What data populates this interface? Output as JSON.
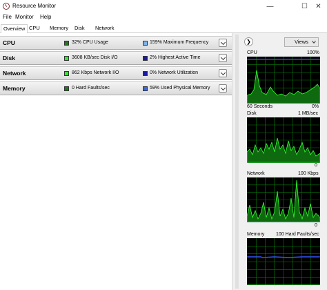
{
  "window": {
    "title": "Resource Monitor",
    "minimize": "—",
    "maximize": "☐",
    "close": "✕"
  },
  "menu": {
    "file": "File",
    "monitor": "Monitor",
    "help": "Help"
  },
  "tabs": {
    "overview": "Overview",
    "cpu": "CPU",
    "memory": "Memory",
    "disk": "Disk",
    "network": "Network"
  },
  "sections": {
    "cpu": {
      "title": "CPU",
      "stat1": "32% CPU Usage",
      "stat1_color": "#1f7a1f",
      "stat2": "159% Maximum Frequency",
      "stat2_color": "#7fb2e8"
    },
    "disk": {
      "title": "Disk",
      "stat1": "3608 KB/sec Disk I/O",
      "stat1_color": "#2ee82e",
      "stat2": "2% Highest Active Time",
      "stat2_color": "#1a1aa0"
    },
    "network": {
      "title": "Network",
      "stat1": "862 Kbps Network I/O",
      "stat1_color": "#2ee82e",
      "stat2": "0% Network Utilization",
      "stat2_color": "#1a1aa0"
    },
    "memory": {
      "title": "Memory",
      "stat1": "0 Hard Faults/sec",
      "stat1_color": "#1f7a1f",
      "stat2": "59% Used Physical Memory",
      "stat2_color": "#3a6ad8"
    }
  },
  "rightpane": {
    "nav_glyph": "❯",
    "views_label": "Views",
    "cpu": {
      "title": "CPU",
      "max": "100%",
      "time": "60 Seconds",
      "min": "0%"
    },
    "disk": {
      "title": "Disk",
      "max": "1 MB/sec",
      "min": "0"
    },
    "network": {
      "title": "Network",
      "max": "100 Kbps",
      "min": "0"
    },
    "memory": {
      "title": "Memory",
      "max": "100 Hard Faults/sec",
      "min": "0"
    }
  },
  "colors": {
    "graph_bg": "#000000",
    "grid": "#0a7a0a",
    "line_green": "#33ff33",
    "line_blue": "#3355ff"
  }
}
